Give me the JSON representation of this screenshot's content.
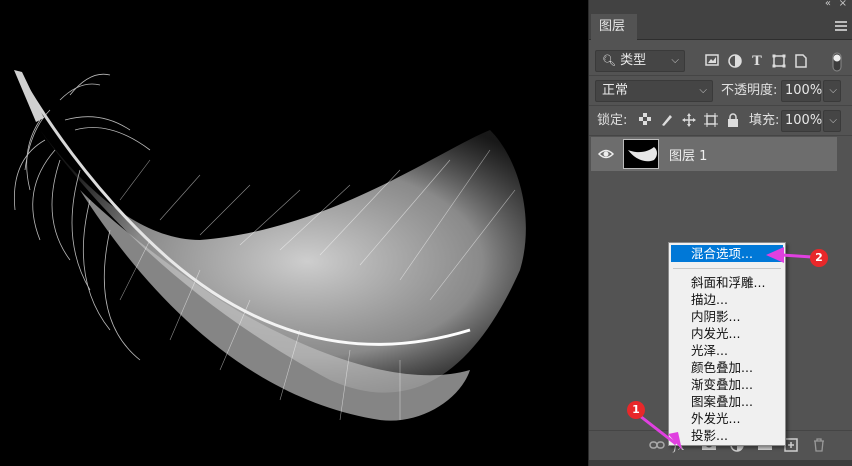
{
  "panel": {
    "tab_title": "图层",
    "filter": {
      "icon": "search-icon",
      "label": "类型"
    },
    "blend_mode": "正常",
    "opacity_label": "不透明度:",
    "opacity_value": "100%",
    "lock_label": "锁定:",
    "fill_label": "填充:",
    "fill_value": "100%",
    "layers": [
      {
        "name": "图层 1",
        "visible": true
      }
    ]
  },
  "context_menu": {
    "items": [
      "混合选项...",
      "斜面和浮雕...",
      "描边...",
      "内阴影...",
      "内发光...",
      "光泽...",
      "颜色叠加...",
      "渐变叠加...",
      "图案叠加...",
      "外发光...",
      "投影..."
    ],
    "selected_index": 0
  },
  "annotations": {
    "badge_1": "1",
    "badge_2": "2",
    "arrow_color": "#e040e0",
    "badge_color": "#e8282a"
  },
  "colors": {
    "panel_bg": "#535353",
    "selected_layer_bg": "#6d6d6d",
    "menu_highlight": "#0078d7"
  }
}
